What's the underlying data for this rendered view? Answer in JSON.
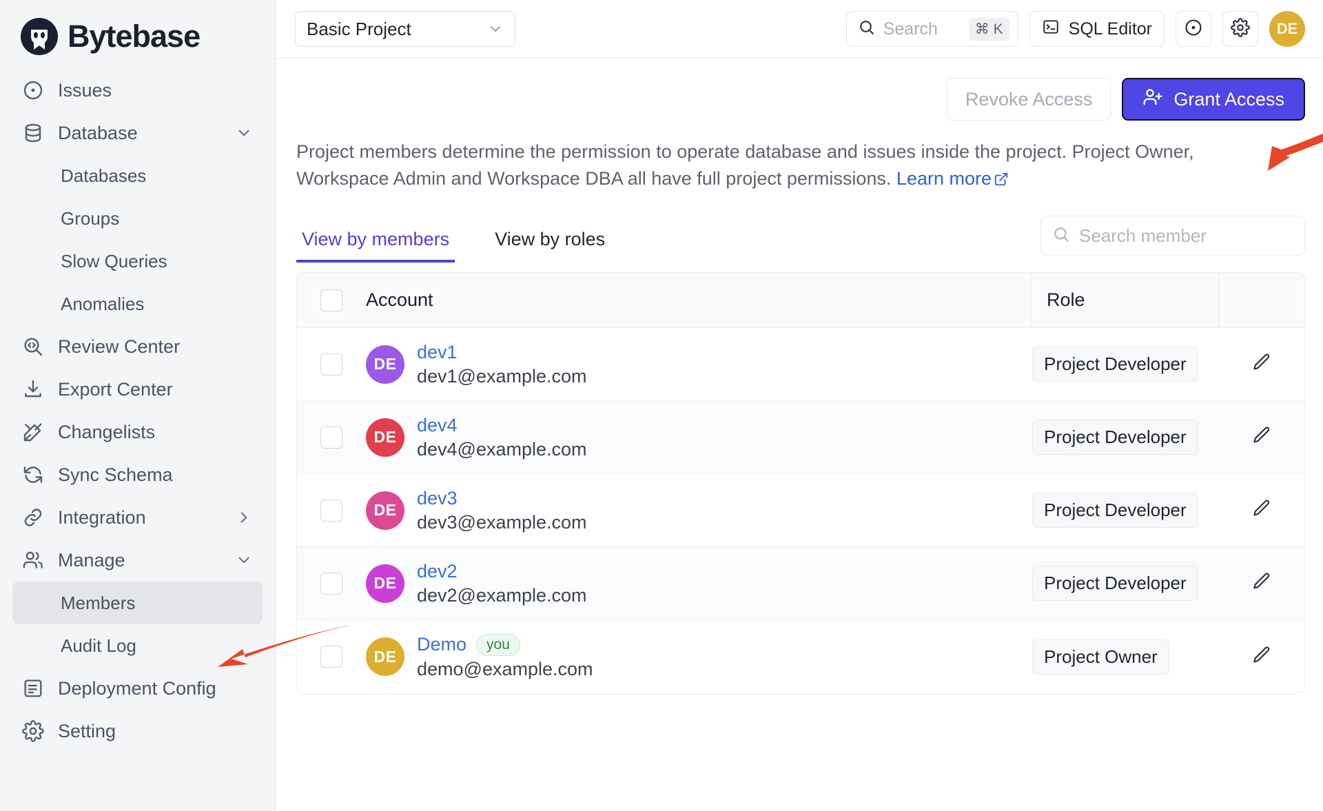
{
  "brand": {
    "name": "Bytebase",
    "logo_icon": "bytebase-logo-icon"
  },
  "sidebar": {
    "items": [
      {
        "label": "Issues",
        "icon": "circle-dot-icon",
        "level": "top",
        "active": false,
        "chevron": ""
      },
      {
        "label": "Database",
        "icon": "database-icon",
        "level": "top",
        "active": false,
        "chevron": "down"
      },
      {
        "label": "Databases",
        "icon": "",
        "level": "child",
        "active": false,
        "chevron": ""
      },
      {
        "label": "Groups",
        "icon": "",
        "level": "child",
        "active": false,
        "chevron": ""
      },
      {
        "label": "Slow Queries",
        "icon": "",
        "level": "child",
        "active": false,
        "chevron": ""
      },
      {
        "label": "Anomalies",
        "icon": "",
        "level": "child",
        "active": false,
        "chevron": ""
      },
      {
        "label": "Review Center",
        "icon": "code-search-icon",
        "level": "top",
        "active": false,
        "chevron": ""
      },
      {
        "label": "Export Center",
        "icon": "download-icon",
        "level": "top",
        "active": false,
        "chevron": ""
      },
      {
        "label": "Changelists",
        "icon": "pencil-ruler-icon",
        "level": "top",
        "active": false,
        "chevron": ""
      },
      {
        "label": "Sync Schema",
        "icon": "refresh-icon",
        "level": "top",
        "active": false,
        "chevron": ""
      },
      {
        "label": "Integration",
        "icon": "link-icon",
        "level": "top",
        "active": false,
        "chevron": "right"
      },
      {
        "label": "Manage",
        "icon": "users-icon",
        "level": "top",
        "active": false,
        "chevron": "down"
      },
      {
        "label": "Members",
        "icon": "",
        "level": "child",
        "active": true,
        "chevron": ""
      },
      {
        "label": "Audit Log",
        "icon": "",
        "level": "child",
        "active": false,
        "chevron": ""
      },
      {
        "label": "Deployment Config",
        "icon": "document-list-icon",
        "level": "top",
        "active": false,
        "chevron": ""
      },
      {
        "label": "Setting",
        "icon": "gear-icon",
        "level": "top",
        "active": false,
        "chevron": ""
      }
    ]
  },
  "topbar": {
    "project_selector": {
      "value": "Basic Project",
      "caret_icon": "chevron-down-icon"
    },
    "search": {
      "placeholder": "Search",
      "shortcut": "⌘ K",
      "icon": "search-icon"
    },
    "sql_editor": {
      "label": "SQL Editor",
      "icon": "terminal-icon"
    },
    "circle_button": {
      "icon": "circle-dot-icon"
    },
    "settings_button": {
      "icon": "gear-icon"
    },
    "avatar": {
      "initials": "DE",
      "color": "#ddae2f"
    }
  },
  "page": {
    "revoke_label": "Revoke Access",
    "grant_label": "Grant Access",
    "grant_icon": "user-plus-icon",
    "grant_color": "#4f46e5",
    "description": "Project members determine the permission to operate database and issues inside the project. Project Owner, Workspace Admin and Workspace DBA all have full project permissions.",
    "learn_more": "Learn more",
    "learn_more_icon": "external-link-icon",
    "tabs": [
      {
        "label": "View by members",
        "active": true
      },
      {
        "label": "View by roles",
        "active": false
      }
    ],
    "member_search": {
      "placeholder": "Search member",
      "icon": "search-icon"
    },
    "accent_color": "#4d42d4"
  },
  "table": {
    "columns": [
      "Account",
      "Role"
    ],
    "rows": [
      {
        "name": "dev1",
        "email": "dev1@example.com",
        "role": "Project Developer",
        "initials": "DE",
        "color": "#9b59e8",
        "badge": "",
        "edit_icon": "pencil-icon"
      },
      {
        "name": "dev4",
        "email": "dev4@example.com",
        "role": "Project Developer",
        "initials": "DE",
        "color": "#e33e4e",
        "badge": "",
        "edit_icon": "pencil-icon"
      },
      {
        "name": "dev3",
        "email": "dev3@example.com",
        "role": "Project Developer",
        "initials": "DE",
        "color": "#db4b95",
        "badge": "",
        "edit_icon": "pencil-icon"
      },
      {
        "name": "dev2",
        "email": "dev2@example.com",
        "role": "Project Developer",
        "initials": "DE",
        "color": "#cc3fd6",
        "badge": "",
        "edit_icon": "pencil-icon"
      },
      {
        "name": "Demo",
        "email": "demo@example.com",
        "role": "Project Owner",
        "initials": "DE",
        "color": "#ddae2f",
        "badge": "you",
        "edit_icon": "pencil-icon"
      }
    ]
  },
  "annotations": {
    "arrow_color": "#e8452a",
    "arrows": [
      {
        "name": "arrow-to-grant-access"
      },
      {
        "name": "arrow-to-members"
      }
    ]
  }
}
